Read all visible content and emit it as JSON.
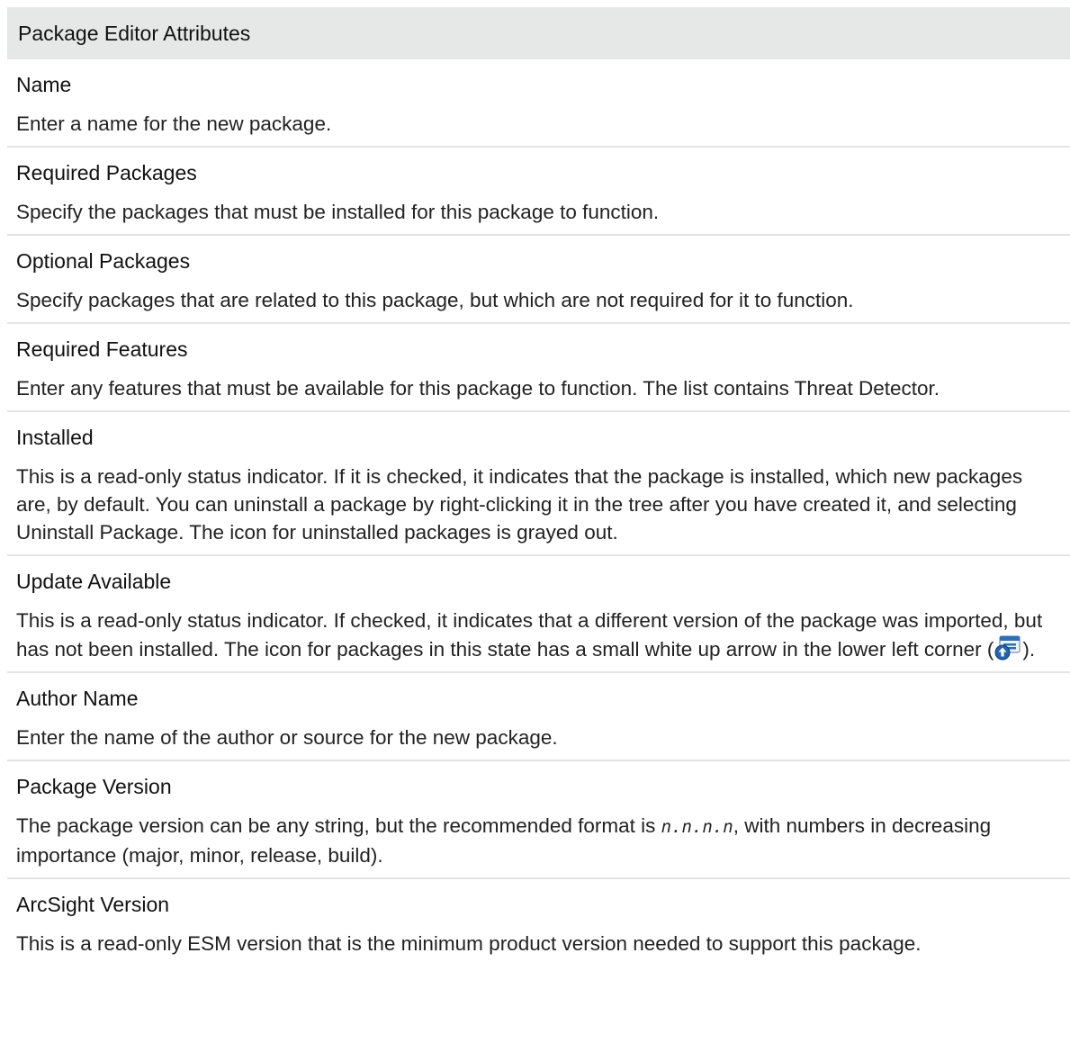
{
  "table": {
    "header": "Package Editor Attributes",
    "rows": [
      {
        "name": "Name",
        "desc": "Enter a name for the new package."
      },
      {
        "name": "Required Packages",
        "desc": "Specify the packages that must be installed for this package to function."
      },
      {
        "name": "Optional Packages",
        "desc": "Specify packages that are related to this package, but which are not required for it to function."
      },
      {
        "name": "Required Features",
        "desc": "Enter any features that must be available for this package to function. The list contains Threat Detector."
      },
      {
        "name": "Installed",
        "desc": "This is a read-only status indicator. If it is checked, it indicates that the package is installed, which new packages are, by default. You can uninstall a package by right-clicking it in the tree after you have created it, and selecting Uninstall Package. The icon for uninstalled packages is grayed out."
      },
      {
        "name": "Update Available",
        "desc_before": "This is a read-only status indicator. If checked, it indicates that a different version of the package was imported, but has not been installed. The icon for packages in this state has a small white up arrow in the lower left corner (",
        "icon": "package-update-icon",
        "desc_after": ")."
      },
      {
        "name": "Author Name",
        "desc": "Enter the name of the author or source for the new package."
      },
      {
        "name": "Package Version",
        "desc_before": "The package version can be any string, but the recommended format is ",
        "code": "n.n.n.n",
        "desc_after": ", with numbers in decreasing importance (major, minor, release, build)."
      },
      {
        "name": "ArcSight Version",
        "desc": "This is a read-only ESM version that is the minimum product version needed to support this package."
      }
    ]
  },
  "colors": {
    "header_bg": "#e6e8e7",
    "divider": "#e4e4e4",
    "text": "#111111",
    "icon_blue": "#2a6fc0"
  }
}
